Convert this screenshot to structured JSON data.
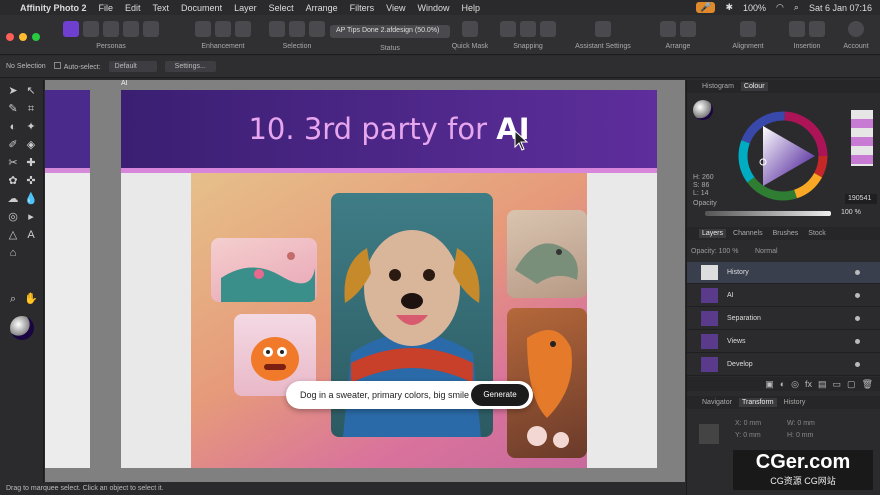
{
  "menubar": {
    "app": "Affinity Photo 2",
    "items": [
      "File",
      "Edit",
      "Text",
      "Document",
      "Layer",
      "Select",
      "Arrange",
      "Filters",
      "View",
      "Window",
      "Help"
    ],
    "battery": "100%",
    "datetime": "Sat 6 Jan  07:16"
  },
  "toolbar": {
    "groups": [
      "Personas",
      "Enhancement",
      "Selection",
      "Status",
      "Quick Mask",
      "Snapping",
      "Assistant Settings",
      "Arrange",
      "Alignment",
      "Insertion",
      "Account"
    ],
    "document": "AP Tips Done 2.afdesign (50.0%)"
  },
  "context": {
    "no_selection": "No Selection",
    "auto_select": "Auto-select:",
    "mode": "Default",
    "settings": "Settings..."
  },
  "canvas": {
    "artboard_label": "AI",
    "title_prefix": "10. 3rd party for ",
    "title_bold": "AI",
    "prompt_text": "Dog in a sweater, primary colors, big smile",
    "generate": "Generate"
  },
  "colour_panel": {
    "tabs": [
      "Histogram",
      "Colour"
    ],
    "h": "H: 260",
    "s": "S: 86",
    "l": "L: 14",
    "hex": "190541",
    "opacity_label": "Opacity",
    "opacity": "100 %"
  },
  "layers_panel": {
    "tabs": [
      "Layers",
      "Channels",
      "Brushes",
      "Stock"
    ],
    "opacity": "Opacity: 100 %",
    "blend": "Normal",
    "layers": [
      "History",
      "AI",
      "Separation",
      "Views",
      "Develop"
    ]
  },
  "transform_panel": {
    "tabs": [
      "Navigator",
      "Transform",
      "History"
    ],
    "x": "X:",
    "y": "Y:",
    "w": "W:",
    "h": "H:",
    "x_val": "0 mm",
    "y_val": "0 mm",
    "w_val": "0 mm",
    "h_val": "0 mm"
  },
  "status": {
    "text": "Drag to marquee select. Click an object to select it."
  },
  "watermark": {
    "big": "CGer.com",
    "small": "CG资源  CG网站"
  }
}
